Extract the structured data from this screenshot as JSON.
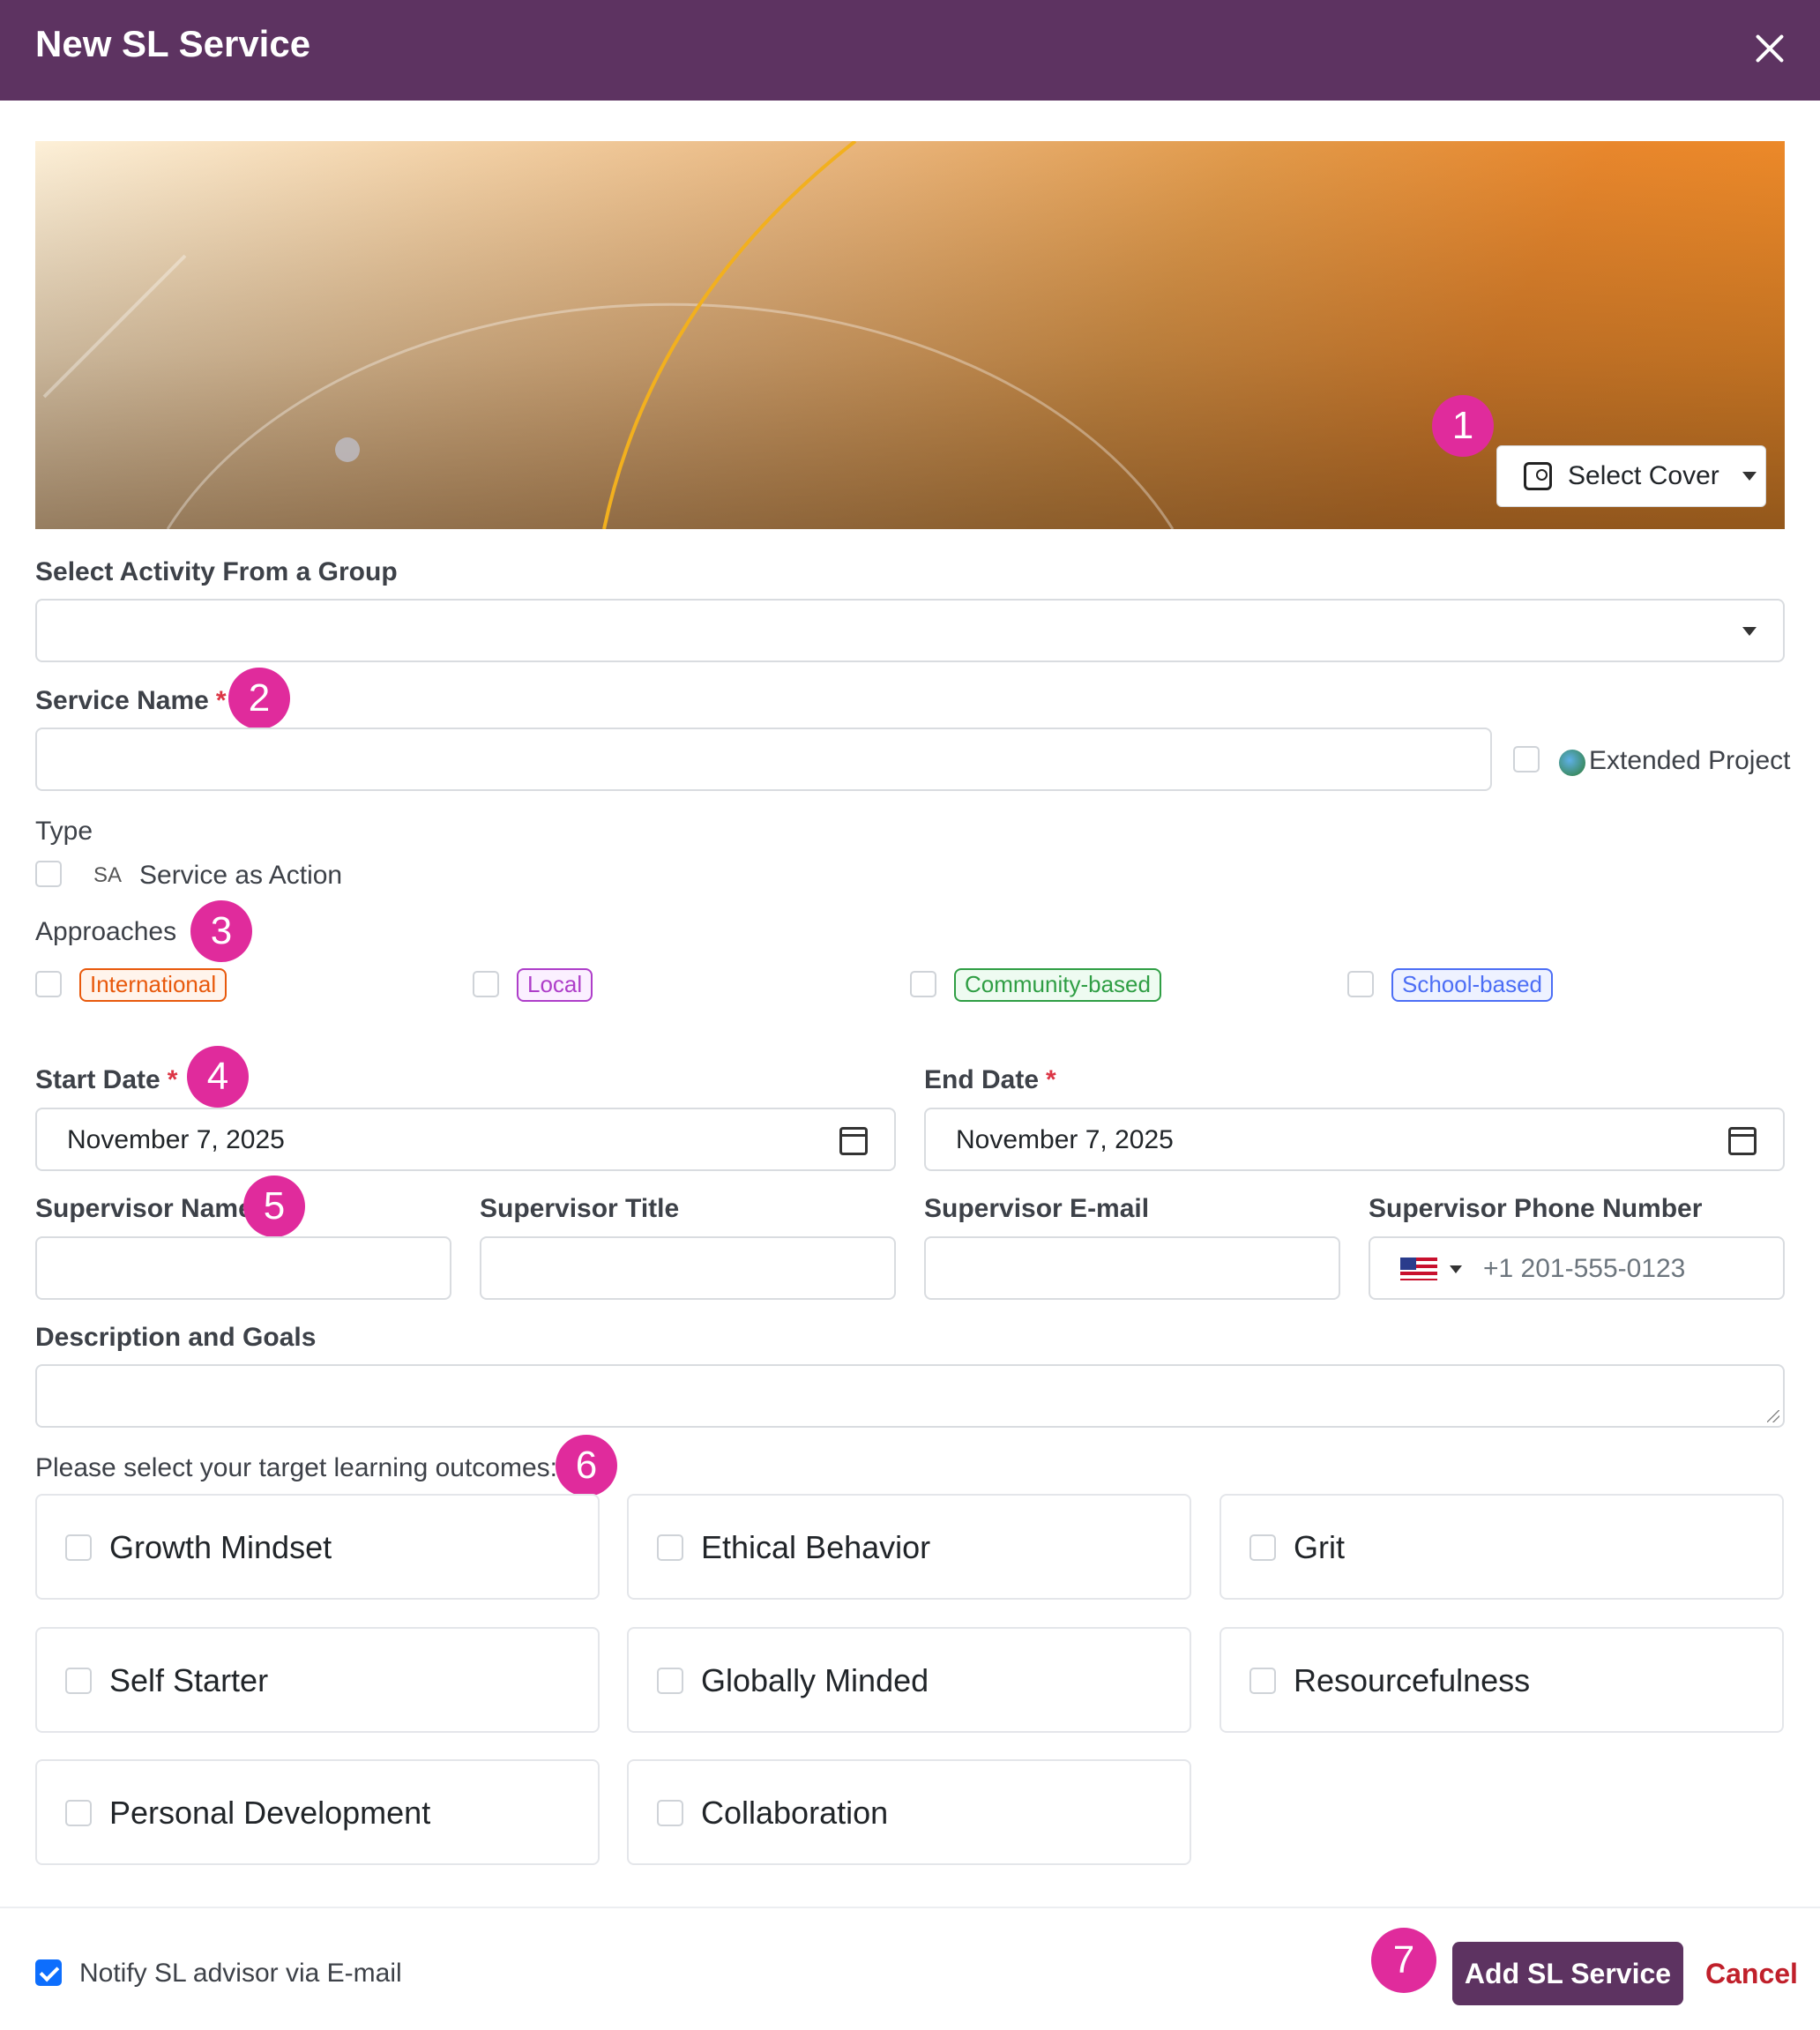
{
  "header": {
    "title": "New SL Service"
  },
  "cover": {
    "select_label": "Select Cover"
  },
  "badges": [
    "1",
    "2",
    "3",
    "4",
    "5",
    "6",
    "7"
  ],
  "activity_group": {
    "label": "Select Activity From a Group",
    "value": ""
  },
  "service_name": {
    "label": "Service Name",
    "required_mark": "*",
    "value": ""
  },
  "extended_project": {
    "label": "Extended Project",
    "checked": false
  },
  "type": {
    "label": "Type",
    "option_code": "SA",
    "option_label": "Service as Action",
    "checked": false
  },
  "approaches": {
    "label": "Approaches",
    "items": [
      {
        "label": "International",
        "color": "#e8590c"
      },
      {
        "label": "Local",
        "color": "#ae3ec9"
      },
      {
        "label": "Community-based",
        "color": "#2f9e44"
      },
      {
        "label": "School-based",
        "color": "#4c6ef5"
      }
    ]
  },
  "start_date": {
    "label": "Start Date",
    "required_mark": "*",
    "value": "November 7, 2025"
  },
  "end_date": {
    "label": "End Date",
    "required_mark": "*",
    "value": "November 7, 2025"
  },
  "supervisor": {
    "name_label": "Supervisor Name",
    "title_label": "Supervisor Title",
    "email_label": "Supervisor E-mail",
    "phone_label": "Supervisor Phone Number",
    "phone_placeholder": "+1 201-555-0123"
  },
  "description": {
    "label": "Description and Goals",
    "value": ""
  },
  "outcomes": {
    "label": "Please select your target learning outcomes:",
    "items": [
      "Growth Mindset",
      "Ethical Behavior",
      "Grit",
      "Self Starter",
      "Globally Minded",
      "Resourcefulness",
      "Personal Development",
      "Collaboration"
    ]
  },
  "footer": {
    "notify_label": "Notify SL advisor via E-mail",
    "notify_checked": true,
    "submit_label": "Add SL Service",
    "cancel_label": "Cancel"
  },
  "colors": {
    "brand": "#5d3361",
    "badge": "#e02b9c",
    "danger": "#c0202b"
  }
}
